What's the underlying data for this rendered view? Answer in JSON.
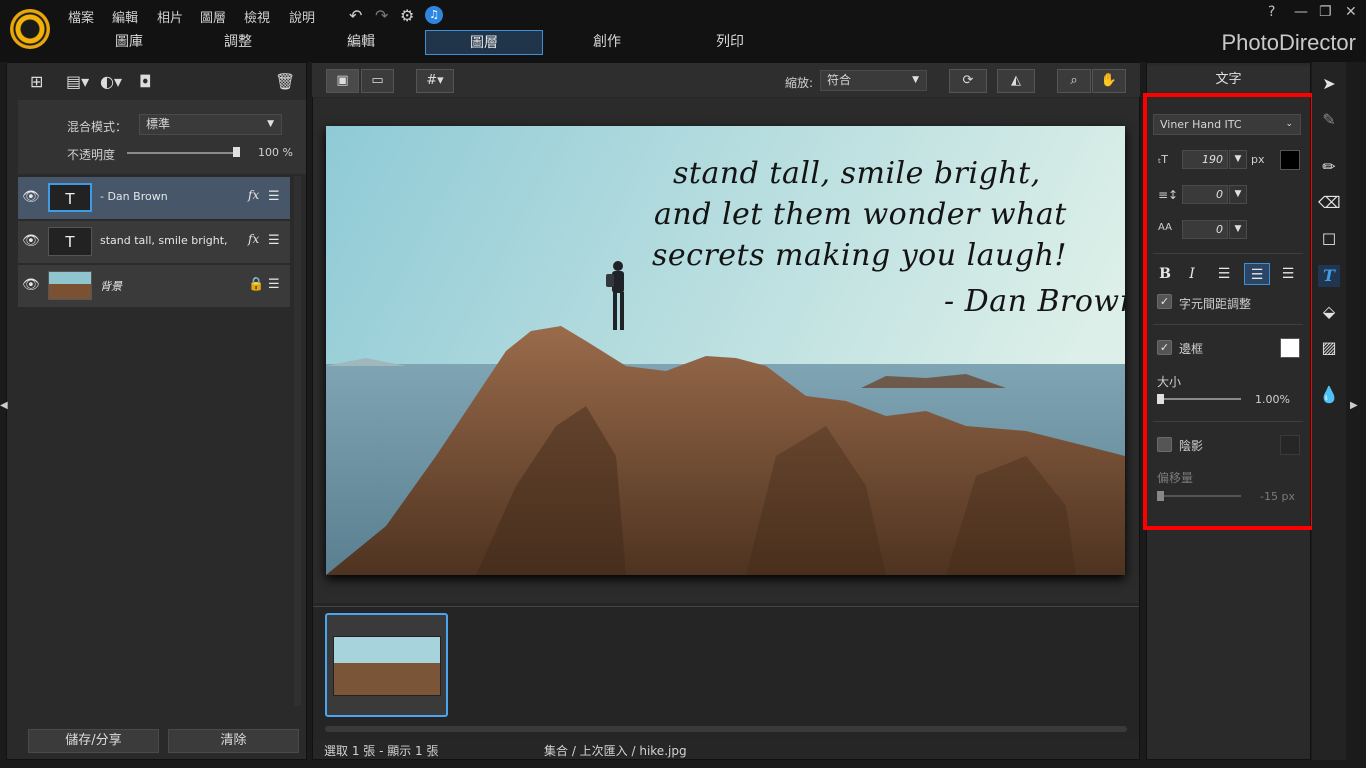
{
  "app": {
    "brand": "PhotoDirector"
  },
  "menu": [
    "檔案",
    "編輯",
    "相片",
    "圖層",
    "檢視",
    "說明"
  ],
  "quick_icons": {
    "undo": "↶",
    "redo": "↷",
    "settings": "⚙",
    "notify": "♫"
  },
  "window_controls": {
    "help": "?",
    "minimize": "—",
    "restore": "❐",
    "close": "✕"
  },
  "tabs": [
    {
      "label": "圖庫"
    },
    {
      "label": "調整"
    },
    {
      "label": "編輯"
    },
    {
      "label": "圖層",
      "active": true
    },
    {
      "label": "創作"
    },
    {
      "label": "列印"
    }
  ],
  "layers_panel": {
    "blend_mode_label": "混合模式：",
    "blend_mode_value": "標準",
    "opacity_label": "不透明度",
    "opacity_value": "100 %",
    "opacity_fraction": 1.0,
    "layers": [
      {
        "name": "- Dan Brown",
        "thumb": "T",
        "selected": true,
        "fx": "fx"
      },
      {
        "name": "stand tall, smile bright,",
        "thumb": "T",
        "selected": false,
        "fx": "fx"
      },
      {
        "name": "背景",
        "thumb": "",
        "selected": false,
        "locked": true
      }
    ],
    "save_share_label": "儲存/分享",
    "clear_label": "清除"
  },
  "toolbar": {
    "zoom_label": "縮放:",
    "zoom_value": "符合"
  },
  "canvas": {
    "quote_lines": [
      "stand tall, smile bright,",
      "and let them wonder what",
      "secrets making you laugh!",
      "- Dan Brown"
    ]
  },
  "status": {
    "selection": "選取 1 張 - 顯示 1 張",
    "path": "集合 / 上次匯入 / hike.jpg"
  },
  "text_panel": {
    "title": "文字",
    "font": "Viner Hand ITC",
    "size_value": "190",
    "size_unit": "px",
    "line_spacing_value": "0",
    "char_spacing_value": "0",
    "bold_label": "B",
    "italic_label": "I",
    "kerning_label": "字元間距調整",
    "kerning_checked": true,
    "border_label": "邊框",
    "border_checked": true,
    "border_color": "#ffffff",
    "size_label": "大小",
    "border_size_value": "1.00%",
    "border_size_fraction": 0.0,
    "shadow_label": "陰影",
    "shadow_checked": false,
    "offset_label": "偏移量",
    "offset_value": "-15 px",
    "text_color": "#000000"
  }
}
